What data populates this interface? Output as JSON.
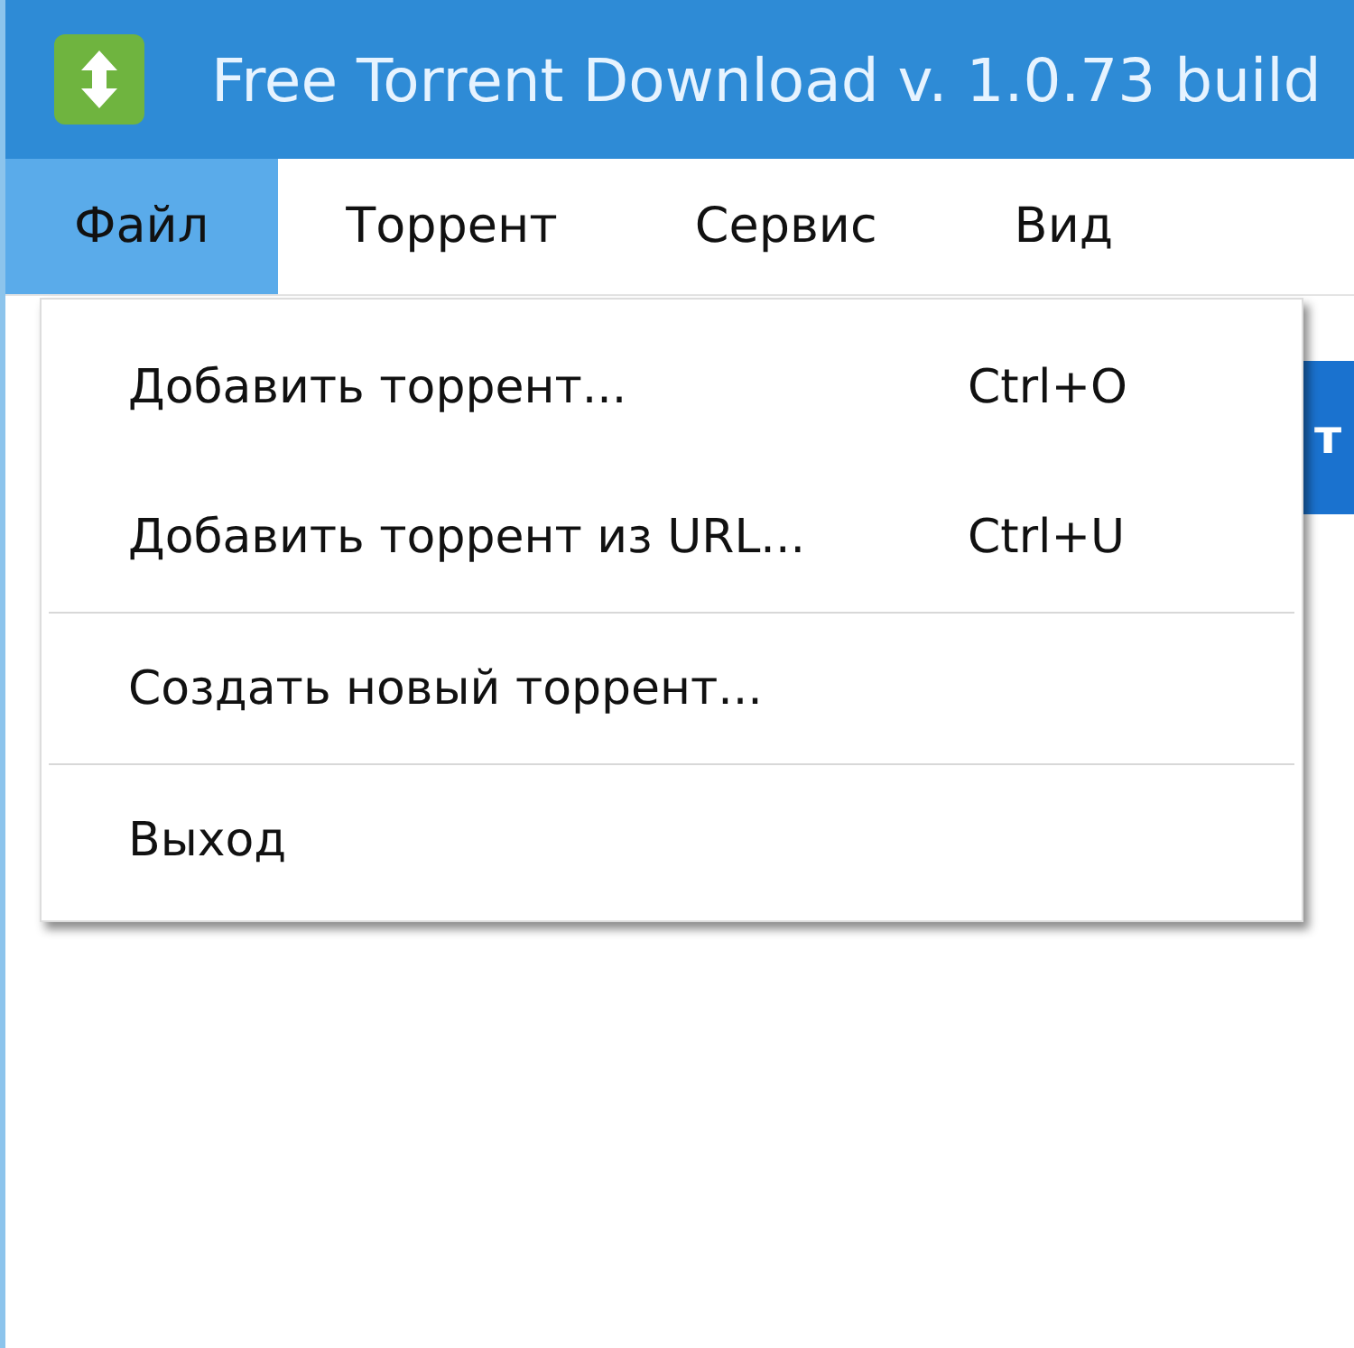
{
  "window": {
    "title": "Free Torrent Download v. 1.0.73 build"
  },
  "menu_bar": [
    {
      "label": "Файл",
      "selected": true
    },
    {
      "label": "Торрент",
      "selected": false
    },
    {
      "label": "Сервис",
      "selected": false
    },
    {
      "label": "Вид",
      "selected": false
    }
  ],
  "toolbar_button_text": "т",
  "file_menu": [
    {
      "kind": "item",
      "label": "Добавить торрент...",
      "shortcut": "Ctrl+O"
    },
    {
      "kind": "item",
      "label": "Добавить торрент из URL...",
      "shortcut": "Ctrl+U"
    },
    {
      "kind": "separator"
    },
    {
      "kind": "item",
      "label": "Создать новый торрент..."
    },
    {
      "kind": "separator"
    },
    {
      "kind": "item",
      "label": "Выход"
    }
  ]
}
